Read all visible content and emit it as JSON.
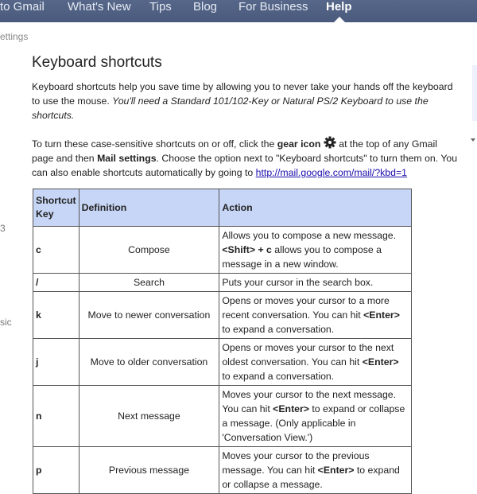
{
  "topnav": {
    "items": [
      {
        "label": "to Gmail"
      },
      {
        "label": "What's New"
      },
      {
        "label": "Tips"
      },
      {
        "label": "Blog"
      },
      {
        "label": "For Business"
      },
      {
        "label": "Help",
        "active": true
      }
    ]
  },
  "breadcrumb": "ettings",
  "left_fragments": [
    "3",
    "sic"
  ],
  "page": {
    "title": "Keyboard shortcuts",
    "intro_plain": "Keyboard shortcuts help you save time by allowing you to never take your hands off the keyboard to use the mouse. ",
    "intro_italic": "You'll need a Standard 101/102-Key or Natural PS/2 Keyboard to use the shortcuts.",
    "instr_1": "To turn these case-sensitive shortcuts on or off, click the ",
    "instr_bold_1": "gear icon",
    "instr_2": " at the top of any Gmail page and then ",
    "instr_bold_2": "Mail settings",
    "instr_3": ". Choose the option next to \"Keyboard shortcuts\" to turn them on. You can also enable shortcuts automatically by going to ",
    "instr_link": "http://mail.google.com/mail/?kbd=1"
  },
  "table": {
    "headers": [
      "Shortcut Key",
      "Definition",
      "Action"
    ],
    "rows": [
      {
        "key": "c",
        "definition": "Compose",
        "action_html": "Allows you to compose a new message. <b>&lt;Shift&gt; + c</b> allows you to compose a message in a new window."
      },
      {
        "key": "/",
        "definition": "Search",
        "action_html": "Puts your cursor in the search box."
      },
      {
        "key": "k",
        "definition": "Move to newer conversation",
        "action_html": "Opens or moves your cursor to a more recent conversation. You can hit <b>&lt;Enter&gt;</b> to expand a conversation."
      },
      {
        "key": "j",
        "definition": "Move to older conversation",
        "action_html": "Opens or moves your cursor to the next oldest conversation. You can hit <b>&lt;Enter&gt;</b> to expand a conversation."
      },
      {
        "key": "n",
        "definition": "Next message",
        "action_html": "Moves your cursor to the next message. You can hit <b>&lt;Enter&gt;</b> to expand or collapse a message. (Only applicable in 'Conversation View.')"
      },
      {
        "key": "p",
        "definition": "Previous message",
        "action_html": "Moves your cursor to the previous message. You can hit <b>&lt;Enter&gt;</b> to expand or collapse a message."
      }
    ]
  },
  "colors": {
    "nav_bg": "#4f6083",
    "table_header_bg": "#c7d6f6",
    "link": "#1a0dab"
  }
}
